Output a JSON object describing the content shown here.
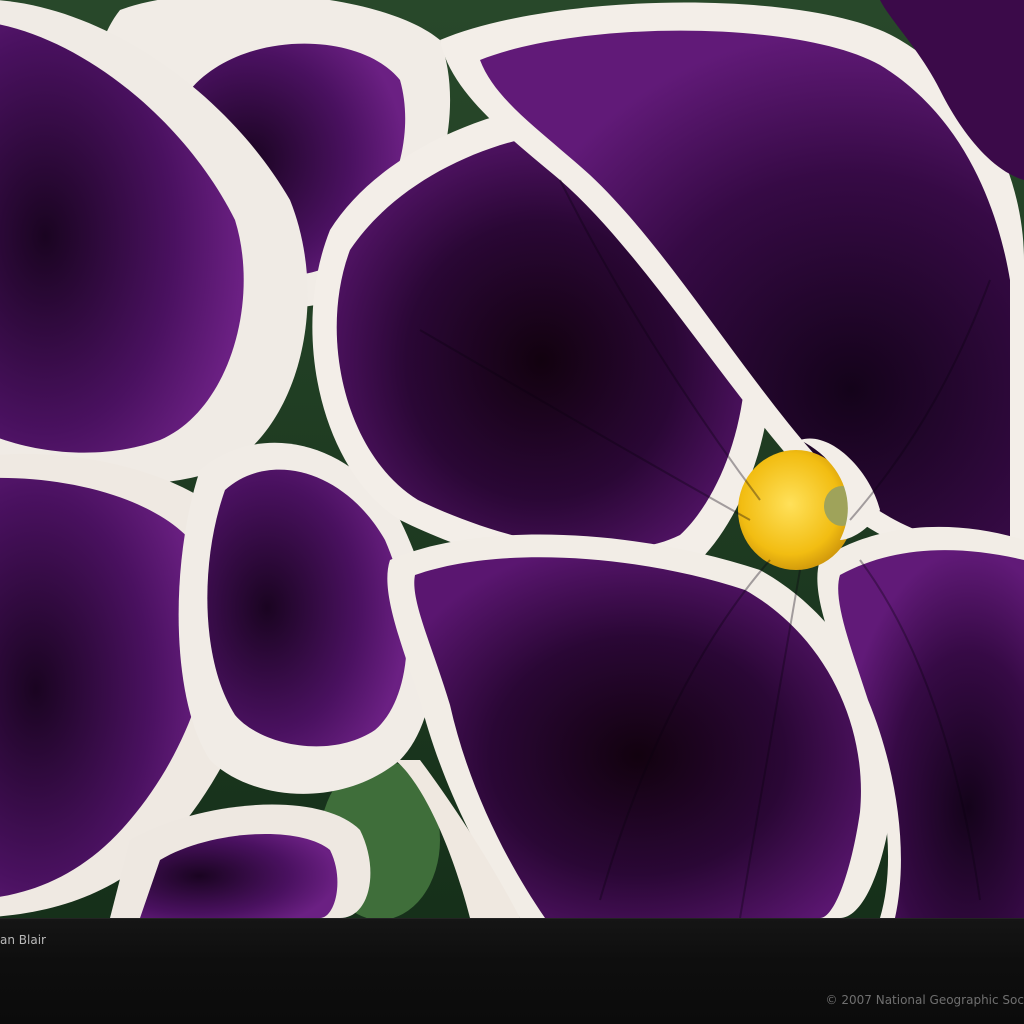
{
  "photo": {
    "subject": "pansy-flowers",
    "colors": {
      "petal_purple": "#3d0a4a",
      "petal_deep": "#1a0420",
      "petal_edge": "#f3ede6",
      "center_yellow": "#f2c21a",
      "leaf_green": "#2f5a2c"
    }
  },
  "caption": {
    "credit": "an Blair",
    "copyright": "© 2007 National Geographic Soc"
  }
}
